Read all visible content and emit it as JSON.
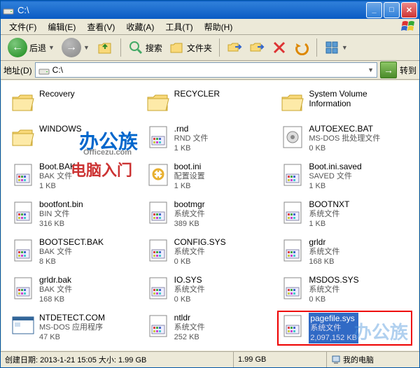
{
  "window": {
    "title": "C:\\",
    "min_label": "_",
    "max_label": "□",
    "close_label": "✕"
  },
  "menu": {
    "file": "文件(F)",
    "edit": "编辑(E)",
    "view": "查看(V)",
    "favorites": "收藏(A)",
    "tools": "工具(T)",
    "help": "帮助(H)"
  },
  "toolbar": {
    "back": "后退",
    "search": "搜索",
    "folders": "文件夹"
  },
  "addressbar": {
    "label": "地址(D)",
    "path": "C:\\",
    "go": "转到"
  },
  "files": [
    {
      "name": "Recovery",
      "type": "",
      "size": "",
      "icon": "folder"
    },
    {
      "name": "RECYCLER",
      "type": "",
      "size": "",
      "icon": "folder"
    },
    {
      "name": "System Volume Information",
      "type": "",
      "size": "",
      "icon": "folder"
    },
    {
      "name": "WINDOWS",
      "type": "",
      "size": "",
      "icon": "folder"
    },
    {
      "name": ".rnd",
      "type": "RND 文件",
      "size": "1 KB",
      "icon": "file"
    },
    {
      "name": "AUTOEXEC.BAT",
      "type": "MS-DOS 批处理文件",
      "size": "0 KB",
      "icon": "gear"
    },
    {
      "name": "Boot.BAK",
      "type": "BAK 文件",
      "size": "1 KB",
      "icon": "sys"
    },
    {
      "name": "boot.ini",
      "type": "配置设置",
      "size": "1 KB",
      "icon": "ini"
    },
    {
      "name": "Boot.ini.saved",
      "type": "SAVED 文件",
      "size": "1 KB",
      "icon": "sys"
    },
    {
      "name": "bootfont.bin",
      "type": "BIN 文件",
      "size": "316 KB",
      "icon": "sys"
    },
    {
      "name": "bootmgr",
      "type": "系统文件",
      "size": "389 KB",
      "icon": "sys"
    },
    {
      "name": "BOOTNXT",
      "type": "系统文件",
      "size": "1 KB",
      "icon": "sys"
    },
    {
      "name": "BOOTSECT.BAK",
      "type": "BAK 文件",
      "size": "8 KB",
      "icon": "sys"
    },
    {
      "name": "CONFIG.SYS",
      "type": "系统文件",
      "size": "0 KB",
      "icon": "sys"
    },
    {
      "name": "grldr",
      "type": "系统文件",
      "size": "168 KB",
      "icon": "sys"
    },
    {
      "name": "grldr.bak",
      "type": "BAK 文件",
      "size": "168 KB",
      "icon": "sys"
    },
    {
      "name": "IO.SYS",
      "type": "系统文件",
      "size": "0 KB",
      "icon": "sys"
    },
    {
      "name": "MSDOS.SYS",
      "type": "系统文件",
      "size": "0 KB",
      "icon": "sys"
    },
    {
      "name": "NTDETECT.COM",
      "type": "MS-DOS 应用程序",
      "size": "47 KB",
      "icon": "app"
    },
    {
      "name": "ntldr",
      "type": "系统文件",
      "size": "252 KB",
      "icon": "sys"
    },
    {
      "name": "pagefile.sys",
      "type": "系统文件",
      "size": "2,097,152 KB",
      "icon": "sys",
      "selected": true
    }
  ],
  "statusbar": {
    "created": "创建日期: 2013-1-21 15:05 大小: 1.99 GB",
    "size": "1.99 GB",
    "location": "我的电脑"
  },
  "watermarks": {
    "w1": "办公族",
    "w1_sub": "Officezu.com",
    "w2": "电脑入门",
    "w3": "办公族"
  }
}
